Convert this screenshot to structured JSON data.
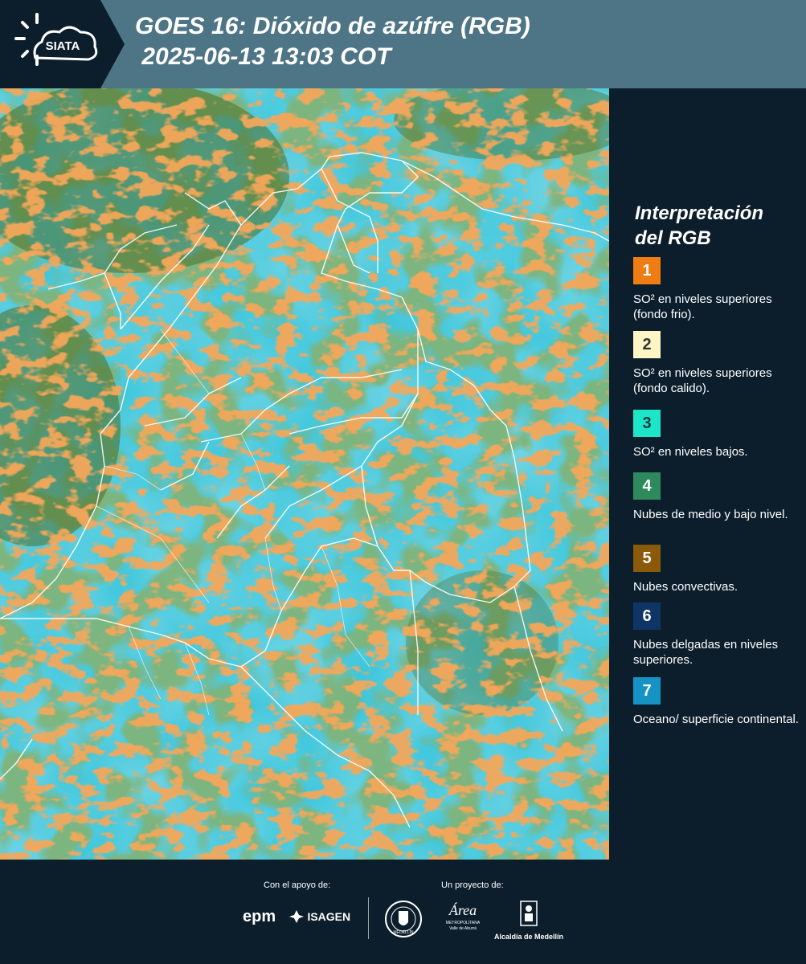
{
  "header": {
    "logo_text": "SIATA",
    "title_line1": "GOES 16: Dióxido de azúfre (RGB)",
    "title_line2": " 2025-06-13 13:03 COT"
  },
  "legend": {
    "title_line1": "Interpretación",
    "title_line2": "del RGB",
    "items": [
      {
        "num": "1",
        "text": "SO² en niveles superiores (fondo frio).",
        "color": "#f07c14",
        "text_color": "#ffffff"
      },
      {
        "num": "2",
        "text": "SO² en niveles superiores (fondo calido).",
        "color": "#fdf5c4",
        "text_color": "#333333"
      },
      {
        "num": "3",
        "text": "SO² en niveles bajos.",
        "color": "#1de6c8",
        "text_color": "#0d3b40"
      },
      {
        "num": "4",
        "text": "Nubes de medio y bajo nivel.",
        "color": "#2e8a5c",
        "text_color": "#ffffff"
      },
      {
        "num": "5",
        "text": "Nubes convectivas.",
        "color": "#8a5a0a",
        "text_color": "#ffffff"
      },
      {
        "num": "6",
        "text": "Nubes delgadas en niveles superiores.",
        "color": "#0e3566",
        "text_color": "#ffffff"
      },
      {
        "num": "7",
        "text": "Oceano/ superficie continental.",
        "color": "#1493c4",
        "text_color": "#ffffff"
      }
    ]
  },
  "footer": {
    "support_label": "Con el apoyo de:",
    "project_label": "Un proyecto de:",
    "logos": {
      "epm": "epm",
      "isagen": "ISAGEN",
      "area_name": "Área",
      "area_sub1": "METROPOLITANA",
      "area_sub2": "Valle de Aburrá",
      "alcaldia": "Alcaldía de Medellín",
      "medellin_seal": "MEDELLÍN"
    }
  },
  "colors": {
    "header_bg": "#4d7586",
    "logo_bg": "#0c1e2c",
    "page_bg": "#0c1e2c",
    "map_cyan": "#3cc6dc",
    "map_orange": "#e8641a",
    "map_green": "#3d7a32"
  }
}
